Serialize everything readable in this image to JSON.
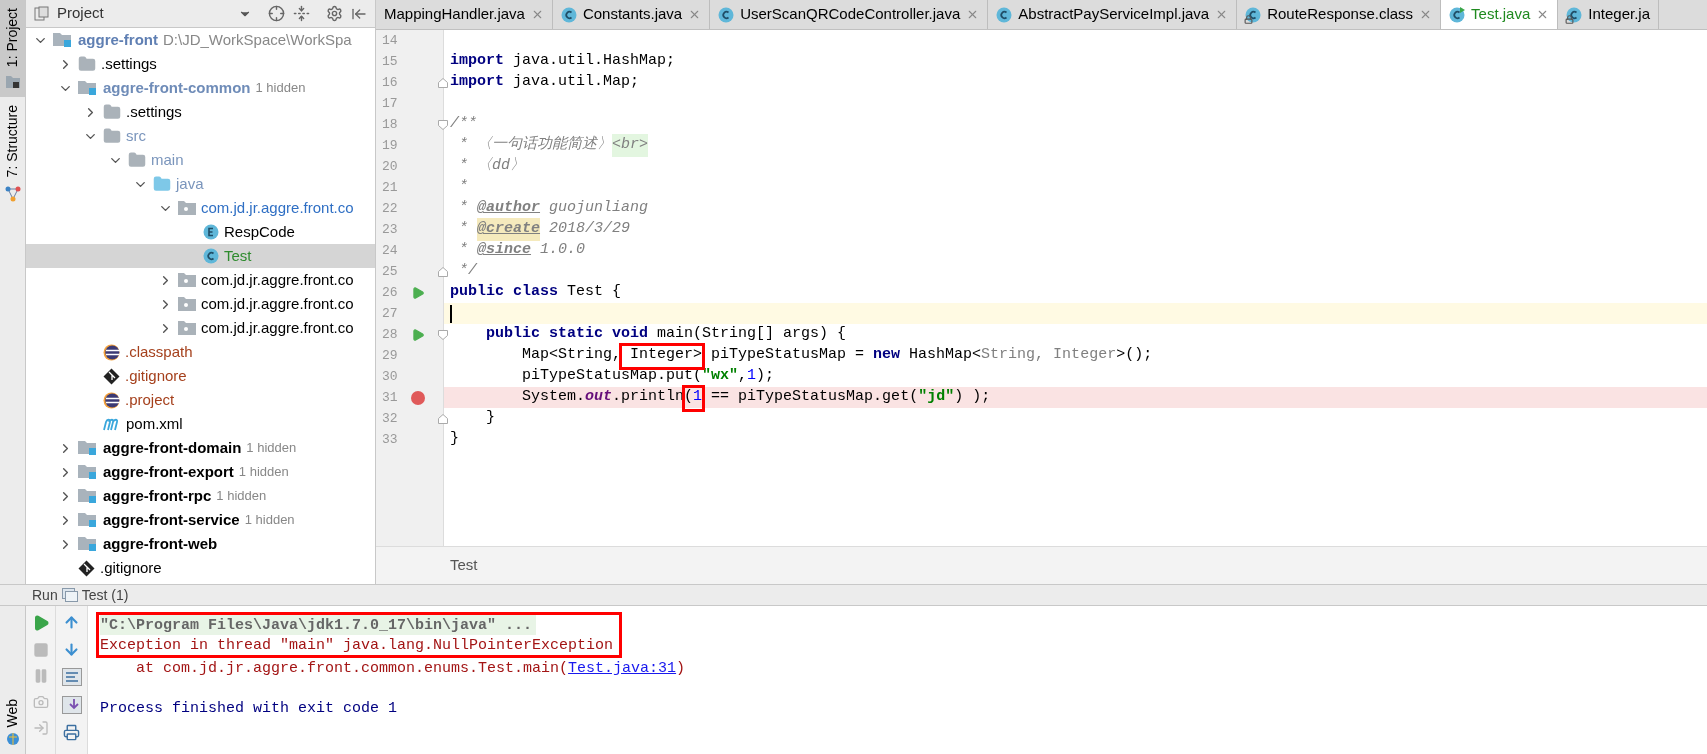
{
  "side_stripe": [
    {
      "label": "1: Project",
      "selected": true
    },
    {
      "label": "7: Structure",
      "selected": false
    }
  ],
  "project_panel": {
    "title": "Project",
    "tree": [
      {
        "label": "aggre-front",
        "suffix": "D:\\JD_WorkSpace\\WorkSpa",
        "kind": "module",
        "color": "#5f7fb3",
        "expanded": true,
        "selected": false,
        "children": [
          {
            "label": ".settings",
            "kind": "folder",
            "color": "#000000",
            "expanded": false,
            "selected": false
          },
          {
            "label": "aggre-front-common",
            "suffix": "1 hidden",
            "kind": "module",
            "color": "#6f8cb8",
            "expanded": true,
            "selected": false,
            "children": [
              {
                "label": ".settings",
                "kind": "folder",
                "color": "#000000",
                "expanded": false,
                "selected": false
              },
              {
                "label": "src",
                "kind": "folder",
                "color": "#7a95bc",
                "expanded": true,
                "selected": false,
                "children": [
                  {
                    "label": "main",
                    "kind": "folder",
                    "color": "#7a95bc",
                    "expanded": true,
                    "selected": false,
                    "children": [
                      {
                        "label": "java",
                        "kind": "source-folder",
                        "color": "#7a95bc",
                        "expanded": true,
                        "selected": false,
                        "children": [
                          {
                            "label": "com.jd.jr.aggre.front.co",
                            "kind": "package",
                            "color": "#2f6fc4",
                            "expanded": true,
                            "selected": false,
                            "children": [
                              {
                                "label": "RespCode",
                                "kind": "enum",
                                "color": "#000000",
                                "selected": false
                              },
                              {
                                "label": "Test",
                                "kind": "class",
                                "color": "#2e8b2e",
                                "selected": true
                              }
                            ]
                          },
                          {
                            "label": "com.jd.jr.aggre.front.co",
                            "kind": "package",
                            "color": "#000000",
                            "expanded": false,
                            "selected": false
                          },
                          {
                            "label": "com.jd.jr.aggre.front.co",
                            "kind": "package",
                            "color": "#000000",
                            "expanded": false,
                            "selected": false
                          },
                          {
                            "label": "com.jd.jr.aggre.front.co",
                            "kind": "package",
                            "color": "#000000",
                            "expanded": false,
                            "selected": false
                          }
                        ]
                      }
                    ]
                  }
                ]
              },
              {
                "label": ".classpath",
                "kind": "eclipse-file",
                "color": "#a5401c",
                "selected": false
              },
              {
                "label": ".gitignore",
                "kind": "git-file",
                "color": "#a5401c",
                "selected": false
              },
              {
                "label": ".project",
                "kind": "eclipse-file",
                "color": "#a5401c",
                "selected": false
              },
              {
                "label": "pom.xml",
                "kind": "maven-file",
                "color": "#000000",
                "selected": false
              }
            ]
          },
          {
            "label": "aggre-front-domain",
            "suffix": "1 hidden",
            "kind": "module",
            "color": "#000000",
            "expanded": false,
            "selected": false
          },
          {
            "label": "aggre-front-export",
            "suffix": "1 hidden",
            "kind": "module",
            "color": "#000000",
            "expanded": false,
            "selected": false
          },
          {
            "label": "aggre-front-rpc",
            "suffix": "1 hidden",
            "kind": "module",
            "color": "#000000",
            "expanded": false,
            "selected": false
          },
          {
            "label": "aggre-front-service",
            "suffix": "1 hidden",
            "kind": "module",
            "color": "#000000",
            "expanded": false,
            "selected": false
          },
          {
            "label": "aggre-front-web",
            "kind": "module",
            "color": "#000000",
            "expanded": false,
            "selected": false
          },
          {
            "label": ".gitignore",
            "kind": "git-file",
            "color": "#000000",
            "selected": false
          }
        ]
      }
    ]
  },
  "editor_tabs": [
    {
      "label": "MappingHandler.java",
      "kind": "plain",
      "selected": false
    },
    {
      "label": "Constants.java",
      "kind": "class",
      "locked": false,
      "selected": false
    },
    {
      "label": "UserScanQRCodeController.java",
      "kind": "class",
      "locked": false,
      "selected": false
    },
    {
      "label": "AbstractPayServiceImpl.java",
      "kind": "class",
      "locked": false,
      "selected": false
    },
    {
      "label": "RouteResponse.class",
      "kind": "class",
      "locked": true,
      "selected": false
    },
    {
      "label": "Test.java",
      "kind": "class-run",
      "locked": false,
      "selected": true
    },
    {
      "label": "Integer.ja",
      "kind": "class",
      "locked": true,
      "selected": false
    }
  ],
  "code_lines": [
    {
      "number": "14",
      "kind": "code",
      "runnable": false,
      "breakpoint": false,
      "current": false
    },
    {
      "number": "15",
      "kind": "code",
      "runnable": false,
      "breakpoint": false,
      "current": false,
      "segments": [
        {
          "text": "import",
          "kind": "keyword",
          "boxed": false
        },
        {
          "text": " java.util.HashMap;",
          "kind": "plain",
          "boxed": false
        }
      ]
    },
    {
      "number": "16",
      "kind": "fold-end",
      "runnable": false,
      "breakpoint": false,
      "current": false,
      "segments": [
        {
          "text": "import",
          "kind": "keyword",
          "boxed": false
        },
        {
          "text": " java.util.Map;",
          "kind": "plain",
          "boxed": false
        }
      ]
    },
    {
      "number": "17",
      "kind": "code",
      "runnable": false,
      "breakpoint": false,
      "current": false
    },
    {
      "number": "18",
      "kind": "fold-start",
      "runnable": false,
      "breakpoint": false,
      "current": false,
      "segments": [
        {
          "text": "/**",
          "kind": "comment",
          "boxed": false
        }
      ]
    },
    {
      "number": "19",
      "kind": "code",
      "runnable": false,
      "breakpoint": false,
      "current": false,
      "segments": [
        {
          "text": " * 〈一句话功能简述〉",
          "kind": "comment",
          "boxed": false
        },
        {
          "text": "<br>",
          "kind": "html-tag",
          "boxed": false
        }
      ]
    },
    {
      "number": "20",
      "kind": "code",
      "runnable": false,
      "breakpoint": false,
      "current": false,
      "segments": [
        {
          "text": " * 〈dd〉",
          "kind": "comment",
          "boxed": false
        }
      ]
    },
    {
      "number": "21",
      "kind": "code",
      "runnable": false,
      "breakpoint": false,
      "current": false,
      "segments": [
        {
          "text": " *",
          "kind": "comment",
          "boxed": false
        }
      ]
    },
    {
      "number": "22",
      "kind": "code",
      "runnable": false,
      "breakpoint": false,
      "current": false,
      "segments": [
        {
          "text": " * ",
          "kind": "comment",
          "boxed": false
        },
        {
          "text": "@author",
          "kind": "doc-tag",
          "boxed": false
        },
        {
          "text": " guojunliang",
          "kind": "comment",
          "boxed": false
        }
      ]
    },
    {
      "number": "23",
      "kind": "code",
      "runnable": false,
      "breakpoint": false,
      "current": false,
      "segments": [
        {
          "text": " * ",
          "kind": "comment",
          "boxed": false
        },
        {
          "text": "@create",
          "kind": "doc-tag-marked",
          "boxed": false
        },
        {
          "text": " 2018/3/29",
          "kind": "comment",
          "boxed": false
        }
      ]
    },
    {
      "number": "24",
      "kind": "code",
      "runnable": false,
      "breakpoint": false,
      "current": false,
      "segments": [
        {
          "text": " * ",
          "kind": "comment",
          "boxed": false
        },
        {
          "text": "@since",
          "kind": "doc-tag",
          "boxed": false
        },
        {
          "text": " 1.0.0",
          "kind": "comment",
          "boxed": false
        }
      ]
    },
    {
      "number": "25",
      "kind": "fold-end",
      "runnable": false,
      "breakpoint": false,
      "current": false,
      "segments": [
        {
          "text": " */",
          "kind": "comment",
          "boxed": false
        }
      ]
    },
    {
      "number": "26",
      "kind": "code",
      "runnable": true,
      "breakpoint": false,
      "current": false,
      "segments": [
        {
          "text": "public class",
          "kind": "keyword",
          "boxed": false
        },
        {
          "text": " Test {",
          "kind": "plain",
          "boxed": false
        }
      ]
    },
    {
      "number": "27",
      "kind": "code",
      "runnable": false,
      "breakpoint": false,
      "current": true
    },
    {
      "number": "28",
      "kind": "fold-start",
      "runnable": true,
      "breakpoint": false,
      "current": false,
      "segments": [
        {
          "text": "    public static void",
          "kind": "keyword",
          "boxed": false
        },
        {
          "text": " main(String[] args) {",
          "kind": "plain",
          "boxed": false
        }
      ]
    },
    {
      "number": "29",
      "kind": "code",
      "runnable": false,
      "breakpoint": false,
      "current": false,
      "segments": [
        {
          "text": "        Map<String,",
          "kind": "plain",
          "boxed": false
        },
        {
          "text": " Integer>",
          "kind": "plain",
          "boxed": true
        },
        {
          "text": " piTypeStatusMap = ",
          "kind": "plain",
          "boxed": false
        },
        {
          "text": "new",
          "kind": "keyword",
          "boxed": false
        },
        {
          "text": " HashMap<",
          "kind": "plain",
          "boxed": false
        },
        {
          "text": "String, Integer",
          "kind": "inferred",
          "boxed": false
        },
        {
          "text": ">();",
          "kind": "plain",
          "boxed": false
        }
      ]
    },
    {
      "number": "30",
      "kind": "code",
      "runnable": false,
      "breakpoint": false,
      "current": false,
      "segments": [
        {
          "text": "        piTypeStatusMap.put(",
          "kind": "plain",
          "boxed": false
        },
        {
          "text": "\"wx\"",
          "kind": "string",
          "boxed": false
        },
        {
          "text": ",",
          "kind": "plain",
          "boxed": false
        },
        {
          "text": "1",
          "kind": "number",
          "boxed": false
        },
        {
          "text": ");",
          "kind": "plain",
          "boxed": false
        }
      ]
    },
    {
      "number": "31",
      "kind": "code",
      "runnable": false,
      "breakpoint": true,
      "current": false,
      "segments": [
        {
          "text": "        System.",
          "kind": "plain",
          "boxed": false
        },
        {
          "text": "out",
          "kind": "static-field",
          "boxed": false
        },
        {
          "text": ".println",
          "kind": "plain",
          "boxed": false
        },
        {
          "text": "(",
          "kind": "plain",
          "boxed": true
        },
        {
          "text": "1",
          "kind": "number",
          "boxed": true
        },
        {
          "text": " == piTypeStatusMap.get(",
          "kind": "plain",
          "boxed": false
        },
        {
          "text": "\"jd\"",
          "kind": "string",
          "boxed": false
        },
        {
          "text": ") );",
          "kind": "plain",
          "boxed": false
        }
      ]
    },
    {
      "number": "32",
      "kind": "fold-end",
      "runnable": false,
      "breakpoint": false,
      "current": false,
      "segments": [
        {
          "text": "    }",
          "kind": "plain",
          "boxed": false
        }
      ]
    },
    {
      "number": "33",
      "kind": "code",
      "runnable": false,
      "breakpoint": false,
      "current": false,
      "segments": [
        {
          "text": "}",
          "kind": "plain",
          "boxed": false
        }
      ]
    }
  ],
  "breadcrumb": "Test",
  "run_panel": {
    "title": "Run",
    "tab": "Test (1)",
    "side_label": "Web",
    "console": [
      {
        "kind": "command",
        "text": "\"C:\\Program Files\\Java\\jdk1.7.0_17\\bin\\java\" ...",
        "boxed": true
      },
      {
        "kind": "error",
        "text": "Exception in thread \"main\" java.lang.NullPointerException",
        "boxed": true
      },
      {
        "kind": "trace",
        "text": "    at com.jd.jr.aggre.front.common.enums.Test.main(",
        "link": "Test.java:31",
        "tail": ")",
        "boxed": false
      },
      {
        "kind": "blank",
        "boxed": false
      },
      {
        "kind": "info",
        "text": "Process finished with exit code 1",
        "boxed": false
      }
    ]
  }
}
